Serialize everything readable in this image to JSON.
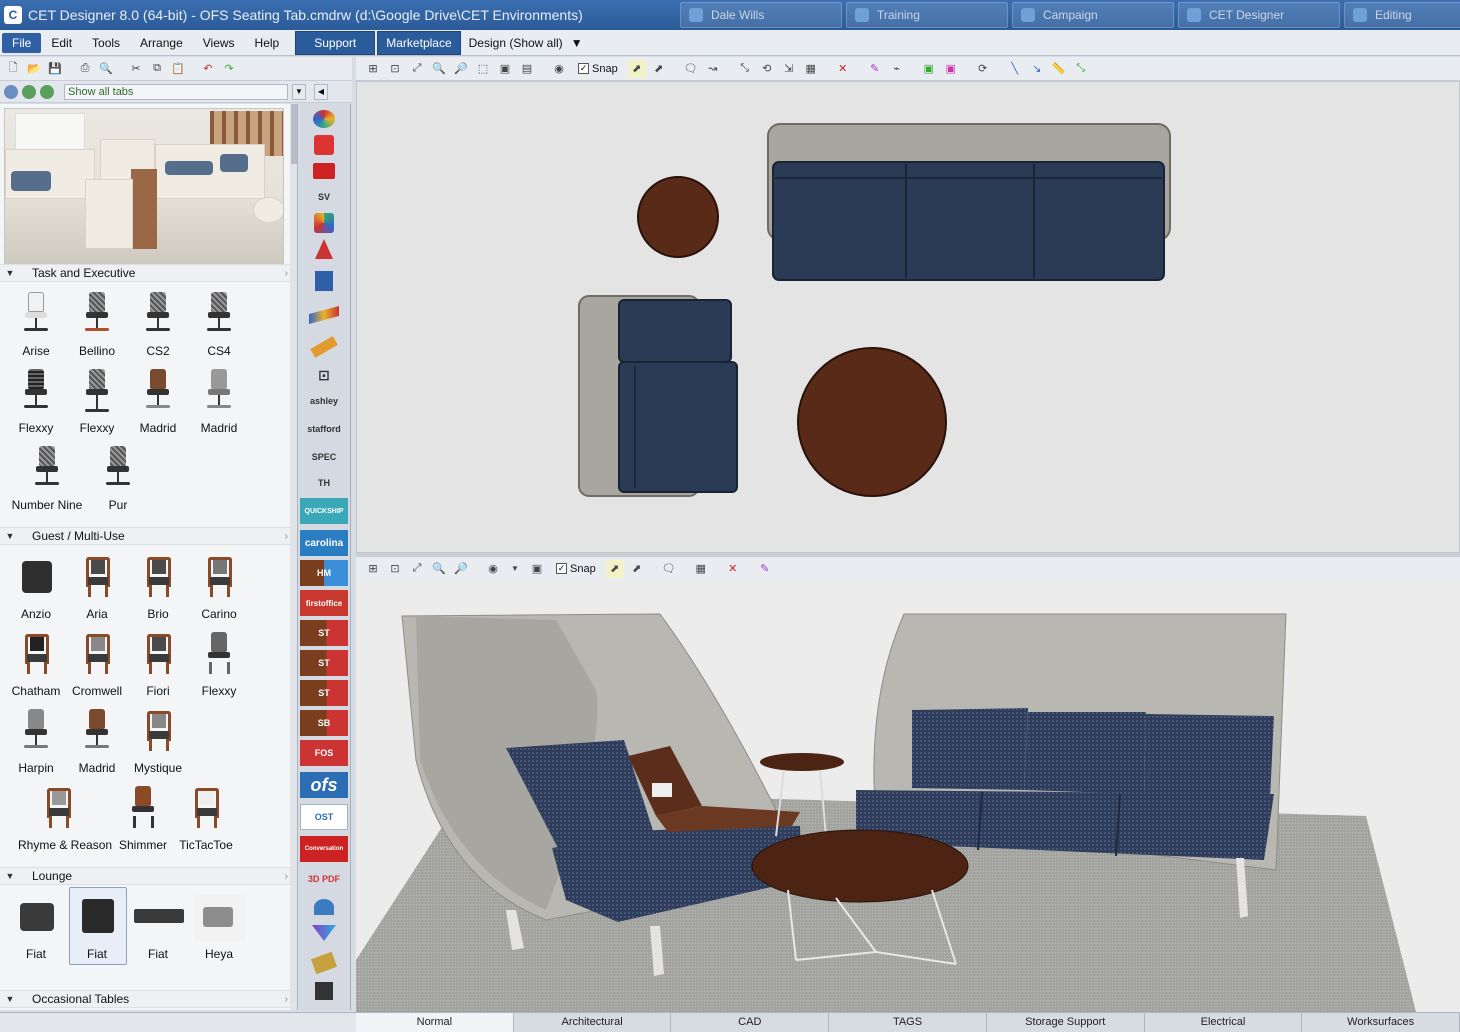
{
  "window": {
    "title": "CET Designer 8.0 (64-bit) - OFS Seating Tab.cmdrw (d:\\Google Drive\\CET Environments)",
    "app_icon": "C",
    "taskbar": [
      "",
      "Dale Wills",
      "Training",
      "Campaign",
      "CET Designer",
      "Editing"
    ]
  },
  "menu": {
    "items": [
      "File",
      "Edit",
      "Tools",
      "Arrange",
      "Views",
      "Help"
    ],
    "support": "Support",
    "marketplace": "Marketplace",
    "design_mode": "Design (Show all)"
  },
  "catalog": {
    "tabs_filter": "Show all tabs",
    "sections": [
      {
        "name": "Task and Executive",
        "items": [
          "Arise",
          "Bellino",
          "CS2",
          "CS4",
          "Flexxy",
          "Flexxy",
          "Madrid",
          "Madrid",
          "Number Nine",
          "Pur"
        ]
      },
      {
        "name": "Guest / Multi-Use",
        "items": [
          "Anzio",
          "Aria",
          "Brio",
          "Carino",
          "Chatham",
          "Cromwell",
          "Fiori",
          "Flexxy",
          "Harpin",
          "Madrid",
          "Mystique",
          "Rhyme & Reason",
          "Shimmer",
          "TicTacToe"
        ]
      },
      {
        "name": "Lounge",
        "items": [
          "Fiat",
          "Fiat",
          "Fiat",
          "Heya"
        ]
      },
      {
        "name": "Occasional Tables",
        "items": []
      }
    ]
  },
  "rail": [
    "",
    "",
    "",
    "SV",
    "",
    "",
    "",
    "",
    "",
    "",
    "ashley",
    "stafford",
    "SPEC",
    "TH",
    "QUICKSHIP",
    "carolina",
    "HM",
    "firstoffice",
    "ST",
    "ST",
    "ST",
    "SB",
    "FOS",
    "ofs",
    "OST",
    "Conversation",
    "3D PDF",
    "",
    "",
    "",
    ""
  ],
  "toolbar": {
    "snap_label": "Snap"
  },
  "bottom_tabs": [
    "Normal",
    "Architectural",
    "CAD",
    "TAGS",
    "Storage Support",
    "Electrical",
    "Worksurfaces"
  ],
  "colors": {
    "accent": "#2f5fa4",
    "upholstery_navy": "#2b3a55",
    "wood": "#5a2a18",
    "shell_gray": "#a9a69f"
  }
}
